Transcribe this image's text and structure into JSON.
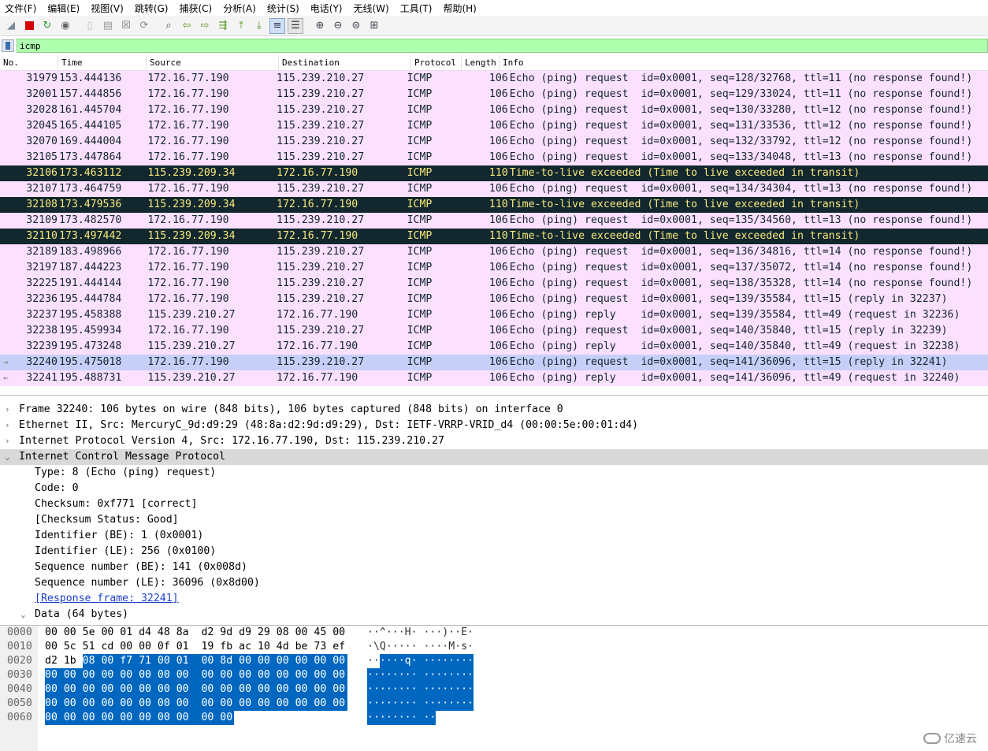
{
  "menu": [
    "文件(F)",
    "编辑(E)",
    "视图(V)",
    "跳转(G)",
    "捕获(C)",
    "分析(A)",
    "统计(S)",
    "电话(Y)",
    "无线(W)",
    "工具(T)",
    "帮助(H)"
  ],
  "filter": {
    "value": "icmp"
  },
  "columns": [
    "No.",
    "Time",
    "Source",
    "Destination",
    "Protocol",
    "Length",
    "Info"
  ],
  "packets": [
    {
      "no": "31979",
      "time": "153.444136",
      "src": "172.16.77.190",
      "dst": "115.239.210.27",
      "proto": "ICMP",
      "len": "106",
      "info": "Echo (ping) request  id=0x0001, seq=128/32768, ttl=11 (no response found!)"
    },
    {
      "no": "32001",
      "time": "157.444856",
      "src": "172.16.77.190",
      "dst": "115.239.210.27",
      "proto": "ICMP",
      "len": "106",
      "info": "Echo (ping) request  id=0x0001, seq=129/33024, ttl=11 (no response found!)"
    },
    {
      "no": "32028",
      "time": "161.445704",
      "src": "172.16.77.190",
      "dst": "115.239.210.27",
      "proto": "ICMP",
      "len": "106",
      "info": "Echo (ping) request  id=0x0001, seq=130/33280, ttl=12 (no response found!)"
    },
    {
      "no": "32045",
      "time": "165.444105",
      "src": "172.16.77.190",
      "dst": "115.239.210.27",
      "proto": "ICMP",
      "len": "106",
      "info": "Echo (ping) request  id=0x0001, seq=131/33536, ttl=12 (no response found!)"
    },
    {
      "no": "32070",
      "time": "169.444004",
      "src": "172.16.77.190",
      "dst": "115.239.210.27",
      "proto": "ICMP",
      "len": "106",
      "info": "Echo (ping) request  id=0x0001, seq=132/33792, ttl=12 (no response found!)"
    },
    {
      "no": "32105",
      "time": "173.447864",
      "src": "172.16.77.190",
      "dst": "115.239.210.27",
      "proto": "ICMP",
      "len": "106",
      "info": "Echo (ping) request  id=0x0001, seq=133/34048, ttl=13 (no response found!)"
    },
    {
      "no": "32106",
      "time": "173.463112",
      "src": "115.239.209.34",
      "dst": "172.16.77.190",
      "proto": "ICMP",
      "len": "110",
      "info": "Time-to-live exceeded (Time to live exceeded in transit)"
    },
    {
      "no": "32107",
      "time": "173.464759",
      "src": "172.16.77.190",
      "dst": "115.239.210.27",
      "proto": "ICMP",
      "len": "106",
      "info": "Echo (ping) request  id=0x0001, seq=134/34304, ttl=13 (no response found!)"
    },
    {
      "no": "32108",
      "time": "173.479536",
      "src": "115.239.209.34",
      "dst": "172.16.77.190",
      "proto": "ICMP",
      "len": "110",
      "info": "Time-to-live exceeded (Time to live exceeded in transit)"
    },
    {
      "no": "32109",
      "time": "173.482570",
      "src": "172.16.77.190",
      "dst": "115.239.210.27",
      "proto": "ICMP",
      "len": "106",
      "info": "Echo (ping) request  id=0x0001, seq=135/34560, ttl=13 (no response found!)"
    },
    {
      "no": "32110",
      "time": "173.497442",
      "src": "115.239.209.34",
      "dst": "172.16.77.190",
      "proto": "ICMP",
      "len": "110",
      "info": "Time-to-live exceeded (Time to live exceeded in transit)"
    },
    {
      "no": "32189",
      "time": "183.498966",
      "src": "172.16.77.190",
      "dst": "115.239.210.27",
      "proto": "ICMP",
      "len": "106",
      "info": "Echo (ping) request  id=0x0001, seq=136/34816, ttl=14 (no response found!)"
    },
    {
      "no": "32197",
      "time": "187.444223",
      "src": "172.16.77.190",
      "dst": "115.239.210.27",
      "proto": "ICMP",
      "len": "106",
      "info": "Echo (ping) request  id=0x0001, seq=137/35072, ttl=14 (no response found!)"
    },
    {
      "no": "32225",
      "time": "191.444144",
      "src": "172.16.77.190",
      "dst": "115.239.210.27",
      "proto": "ICMP",
      "len": "106",
      "info": "Echo (ping) request  id=0x0001, seq=138/35328, ttl=14 (no response found!)"
    },
    {
      "no": "32236",
      "time": "195.444784",
      "src": "172.16.77.190",
      "dst": "115.239.210.27",
      "proto": "ICMP",
      "len": "106",
      "info": "Echo (ping) request  id=0x0001, seq=139/35584, ttl=15 (reply in 32237)"
    },
    {
      "no": "32237",
      "time": "195.458388",
      "src": "115.239.210.27",
      "dst": "172.16.77.190",
      "proto": "ICMP",
      "len": "106",
      "info": "Echo (ping) reply    id=0x0001, seq=139/35584, ttl=49 (request in 32236)"
    },
    {
      "no": "32238",
      "time": "195.459934",
      "src": "172.16.77.190",
      "dst": "115.239.210.27",
      "proto": "ICMP",
      "len": "106",
      "info": "Echo (ping) request  id=0x0001, seq=140/35840, ttl=15 (reply in 32239)"
    },
    {
      "no": "32239",
      "time": "195.473248",
      "src": "115.239.210.27",
      "dst": "172.16.77.190",
      "proto": "ICMP",
      "len": "106",
      "info": "Echo (ping) reply    id=0x0001, seq=140/35840, ttl=49 (request in 32238)"
    },
    {
      "no": "32240",
      "time": "195.475018",
      "src": "172.16.77.190",
      "dst": "115.239.210.27",
      "proto": "ICMP",
      "len": "106",
      "info": "Echo (ping) request  id=0x0001, seq=141/36096, ttl=15 (reply in 32241)"
    },
    {
      "no": "32241",
      "time": "195.488731",
      "src": "115.239.210.27",
      "dst": "172.16.77.190",
      "proto": "ICMP",
      "len": "106",
      "info": "Echo (ping) reply    id=0x0001, seq=141/36096, ttl=49 (request in 32240)"
    }
  ],
  "row_types": [
    "echo",
    "echo",
    "echo",
    "echo",
    "echo",
    "echo",
    "ttl",
    "echo",
    "ttl",
    "echo",
    "ttl",
    "echo",
    "echo",
    "echo",
    "echo",
    "echo",
    "echo",
    "echo",
    "sel",
    "echo"
  ],
  "details": {
    "frame": "Frame 32240: 106 bytes on wire (848 bits), 106 bytes captured (848 bits) on interface 0",
    "ethernet": "Ethernet II, Src: MercuryC_9d:d9:29 (48:8a:d2:9d:d9:29), Dst: IETF-VRRP-VRID_d4 (00:00:5e:00:01:d4)",
    "ip": "Internet Protocol Version 4, Src: 172.16.77.190, Dst: 115.239.210.27",
    "icmp": "Internet Control Message Protocol",
    "icmp_fields": [
      "Type: 8 (Echo (ping) request)",
      "Code: 0",
      "Checksum: 0xf771 [correct]",
      "[Checksum Status: Good]",
      "Identifier (BE): 1 (0x0001)",
      "Identifier (LE): 256 (0x0100)",
      "Sequence number (BE): 141 (0x008d)",
      "Sequence number (LE): 36096 (0x8d00)"
    ],
    "response_link": "[Response frame: 32241]",
    "data": "Data (64 bytes)"
  },
  "bytes": [
    {
      "offset": "0000",
      "hex": "00 00 5e 00 01 d4 48 8a  d2 9d d9 29 08 00 45 00",
      "ascii": "··^···H· ···)··E·"
    },
    {
      "offset": "0010",
      "hex": "00 5c 51 cd 00 00 0f 01  19 fb ac 10 4d be 73 ef",
      "ascii": "·\\Q····· ····M·s·"
    },
    {
      "offset": "0020",
      "hex": "d2 1b 08 00 f7 71 00 01  00 8d 00 00 00 00 00 00",
      "ascii": "······q· ········"
    },
    {
      "offset": "0030",
      "hex": "00 00 00 00 00 00 00 00  00 00 00 00 00 00 00 00",
      "ascii": "········ ········"
    },
    {
      "offset": "0040",
      "hex": "00 00 00 00 00 00 00 00  00 00 00 00 00 00 00 00",
      "ascii": "········ ········"
    },
    {
      "offset": "0050",
      "hex": "00 00 00 00 00 00 00 00  00 00 00 00 00 00 00 00",
      "ascii": "········ ········"
    },
    {
      "offset": "0060",
      "hex": "00 00 00 00 00 00 00 00  00 00",
      "ascii": "········ ··"
    }
  ],
  "watermark": "亿速云",
  "colors": {
    "echo_row": "#fce0ff",
    "ttl_row_bg": "#12272e",
    "ttl_row_fg": "#f7e87c",
    "selected_row": "#c6cff8",
    "filter_bg": "#afffaf",
    "byte_highlight": "#0067c0"
  }
}
